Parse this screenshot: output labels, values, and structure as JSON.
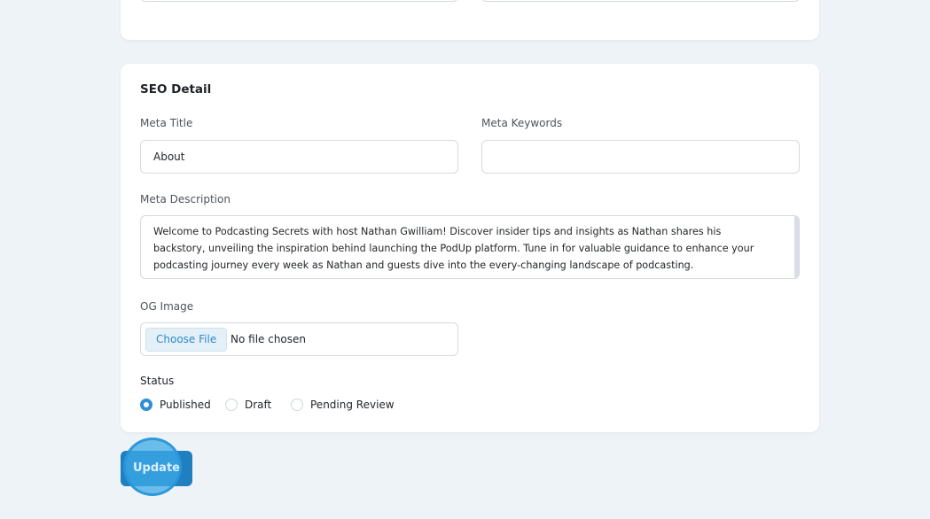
{
  "seo": {
    "title": "SEO Detail",
    "meta_title_label": "Meta Title",
    "meta_title_value": "About",
    "meta_keywords_label": "Meta Keywords",
    "meta_keywords_value": "",
    "meta_description_label": "Meta Description",
    "meta_description_value": "Welcome to Podcasting Secrets with host Nathan Gwilliam! Discover insider tips and insights as Nathan shares his backstory, unveiling the inspiration behind launching the PodUp platform. Tune in for valuable guidance to enhance your podcasting journey every week as Nathan and guests dive into the every-changing landscape of podcasting.",
    "og_image_label": "OG Image",
    "choose_file_label": "Choose File",
    "no_file_label": "No file chosen",
    "status_label": "Status",
    "status_options": [
      "Published",
      "Draft",
      "Pending Review"
    ],
    "status_selected": "Published"
  },
  "actions": {
    "update_label": "Update"
  },
  "colors": {
    "accent": "#2e8fd4",
    "button": "#1f7fc1",
    "background": "#eef3f7"
  }
}
